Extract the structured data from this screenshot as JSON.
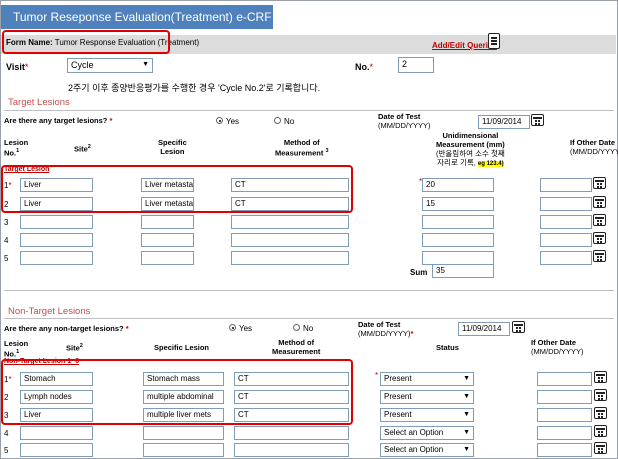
{
  "window": {
    "title": "Tumor Reseponse Evaluation(Treatment)  e-CRF"
  },
  "form": {
    "name_label": "Form Name:",
    "name_value": "Tumor Response Evaluation (Treatment)",
    "add_edit": "Add/Edit Queries"
  },
  "visit": {
    "label": "Visit",
    "req": "*",
    "value": "Cycle",
    "no_label": "No.",
    "no_req": "*",
    "no_value": "2",
    "note": "2주기 이후 종양반응평가를 수행한 경우 'Cycle No.2'로 기록합니다."
  },
  "target": {
    "section_title": "Target Lesions",
    "question": "Are there any target lesions?",
    "req": "*",
    "yes": "Yes",
    "no": "No",
    "date_label": "Date of Test",
    "date_format": "(MM/DD/YYYY)",
    "date_value": "11/09/2014",
    "col_lesion": "Lesion",
    "col_no": "No.",
    "col_site": "Site",
    "col_specific": "Specific",
    "col_lesion2": "Lesion",
    "col_method": "Method of",
    "col_measurement": "Measurement",
    "col_uni": "Unidimensional",
    "col_meas_mm": "Measurement (mm)",
    "col_meas_note": "(반올림하여 소수 첫째",
    "col_meas_note2": "자리로 기록,",
    "col_meas_eg": "eg 123.4)",
    "col_other1": "If Other Date",
    "col_other2": "(MM/DD/YYYY)",
    "group_link": "Target Lesion",
    "rows": [
      {
        "no": "1",
        "req": "*",
        "site": "Liver",
        "specific": "Liver metastasis",
        "method": "CT",
        "meas": "20",
        "meas_req": "*"
      },
      {
        "no": "2",
        "req": "",
        "site": "Liver",
        "specific": "Liver metastasis",
        "method": "CT",
        "meas": "15",
        "meas_req": ""
      },
      {
        "no": "3",
        "req": "",
        "site": "",
        "specific": "",
        "method": "",
        "meas": "",
        "meas_req": ""
      },
      {
        "no": "4",
        "req": "",
        "site": "",
        "specific": "",
        "method": "",
        "meas": "",
        "meas_req": ""
      },
      {
        "no": "5",
        "req": "",
        "site": "",
        "specific": "",
        "method": "",
        "meas": "",
        "meas_req": ""
      }
    ],
    "sum_label": "Sum",
    "sum_value": "35"
  },
  "nontarget": {
    "section_title": "Non-Target Lesions",
    "question": "Are there any non-target lesions?",
    "req": "*",
    "yes": "Yes",
    "no": "No",
    "date_label": "Date of Test",
    "date_format": "(MM/DD/YYYY)",
    "date_req": "*",
    "date_value": "11/09/2014",
    "col_lesion": "Lesion",
    "col_no": "No.",
    "col_site": "Site",
    "col_specific": "Specific Lesion",
    "col_method": "Method of",
    "col_measurement": "Measurement",
    "col_status": "Status",
    "col_other1": "If Other Date",
    "col_other2": "(MM/DD/YYYY)",
    "group_link": "Non-Target Lesion 1~6",
    "rows": [
      {
        "no": "1",
        "req": "*",
        "site": "Stomach",
        "specific": "Stomach mass",
        "method": "CT",
        "status": "Present",
        "status_req": "*"
      },
      {
        "no": "2",
        "req": "",
        "site": "Lymph nodes",
        "specific": "multiple abdominal",
        "method": "CT",
        "status": "Present",
        "status_req": ""
      },
      {
        "no": "3",
        "req": "",
        "site": "Liver",
        "specific": "multiple liver mets",
        "method": "CT",
        "status": "Present",
        "status_req": ""
      },
      {
        "no": "4",
        "req": "",
        "site": "",
        "specific": "",
        "method": "",
        "status": "Select an Option",
        "status_req": ""
      },
      {
        "no": "5",
        "req": "",
        "site": "",
        "specific": "",
        "method": "",
        "status": "Select an Option",
        "status_req": ""
      }
    ]
  },
  "icons": {
    "queries": "document-icon",
    "calendar": "calendar-icon"
  },
  "colors": {
    "title_bar": "#4f81bd",
    "highlight_box": "#e00000",
    "section_title": "#c0504d",
    "required": "#c00000"
  }
}
